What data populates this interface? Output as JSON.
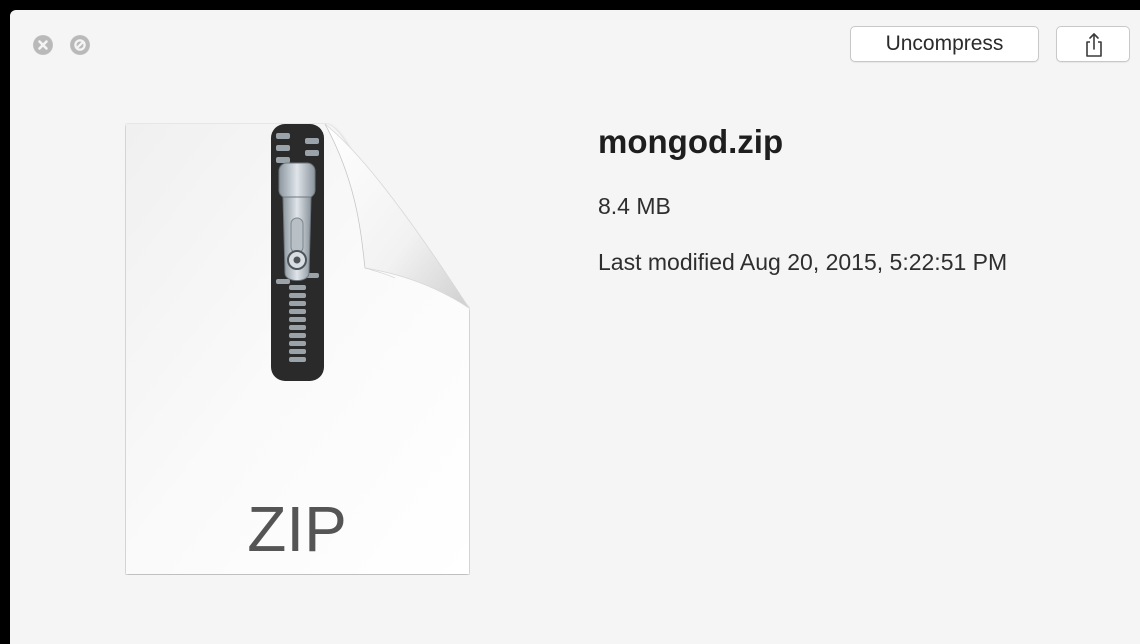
{
  "window": {
    "controls": [
      {
        "name": "close",
        "icon": "close-icon"
      },
      {
        "name": "fullscreen",
        "icon": "fullscreen-icon"
      }
    ]
  },
  "toolbar": {
    "uncompress_label": "Uncompress",
    "share_icon": "share-icon"
  },
  "file": {
    "name": "mongod.zip",
    "size": "8.4 MB",
    "modified": "Last modified Aug 20, 2015, 5:22:51 PM",
    "icon_label": "ZIP",
    "icon": "zip-archive-icon"
  },
  "colors": {
    "background": "#f5f5f5",
    "frame": "#000000",
    "text": "#1e1e1e"
  }
}
